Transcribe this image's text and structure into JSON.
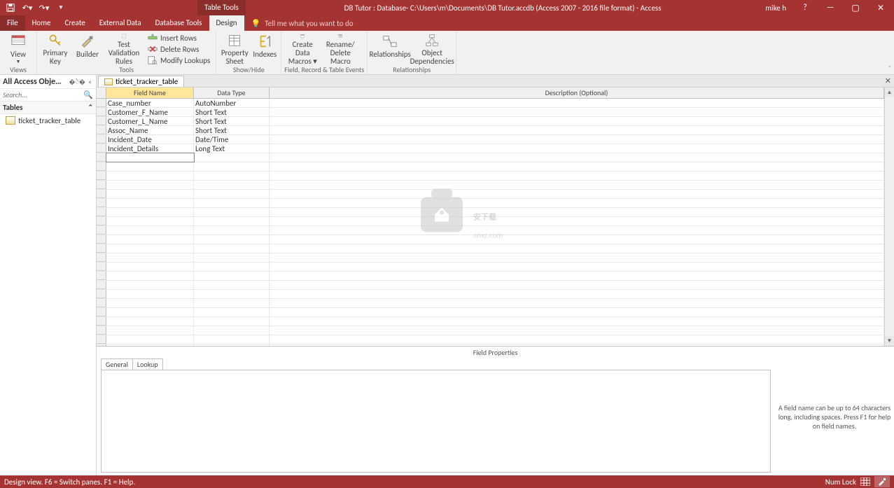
{
  "titlebar": {
    "tabletools": "Table Tools",
    "title": "DB Tutor : Database- C:\\Users\\m\\Documents\\DB Tutor.accdb (Access 2007 - 2016 file format) - Access",
    "user": "mike h"
  },
  "menu": {
    "file": "File",
    "tabs": [
      "Home",
      "Create",
      "External Data",
      "Database Tools",
      "Design"
    ],
    "active": "Design",
    "tellme_placeholder": "Tell me what you want to do"
  },
  "ribbon": {
    "groups": {
      "views": {
        "label": "Views",
        "view": "View"
      },
      "tools": {
        "label": "Tools",
        "primary": "Primary Key",
        "builder": "Builder",
        "test": "Test Validation Rules",
        "insert": "Insert Rows",
        "delete": "Delete Rows",
        "modify": "Modify Lookups"
      },
      "showhide": {
        "label": "Show/Hide",
        "prop": "Property Sheet",
        "indexes": "Indexes"
      },
      "events": {
        "label": "Field, Record & Table Events",
        "create": "Create Data Macros ▾",
        "rename": "Rename/ Delete Macro"
      },
      "relationships": {
        "label": "Relationships",
        "rel": "Relationships",
        "obj": "Object Dependencies"
      }
    }
  },
  "nav": {
    "title": "All Access Obje…",
    "search_placeholder": "Search...",
    "group": "Tables",
    "items": [
      "ticket_tracker_table"
    ]
  },
  "doc": {
    "tab": "ticket_tracker_table"
  },
  "grid": {
    "headers": {
      "field": "Field Name",
      "type": "Data Type",
      "desc": "Description (Optional)"
    },
    "rows": [
      {
        "field": "Case_number",
        "type": "AutoNumber"
      },
      {
        "field": "Customer_F_Name",
        "type": "Short Text"
      },
      {
        "field": "Customer_L_Name",
        "type": "Short Text"
      },
      {
        "field": "Assoc_Name",
        "type": "Short Text"
      },
      {
        "field": "Incident_Date",
        "type": "Date/Time"
      },
      {
        "field": "Incident_Details",
        "type": "Long Text"
      }
    ],
    "blank_rows": 22
  },
  "fieldprops": {
    "title": "Field Properties",
    "tabs": [
      "General",
      "Lookup"
    ],
    "help": "A field name can be up to 64 characters long, including spaces. Press F1 for help on field names."
  },
  "statusbar": {
    "left": "Design view.   F6 = Switch panes.   F1 = Help.",
    "numlock": "Num Lock"
  },
  "watermark": {
    "text": "安下载",
    "url": "anxz.com"
  }
}
